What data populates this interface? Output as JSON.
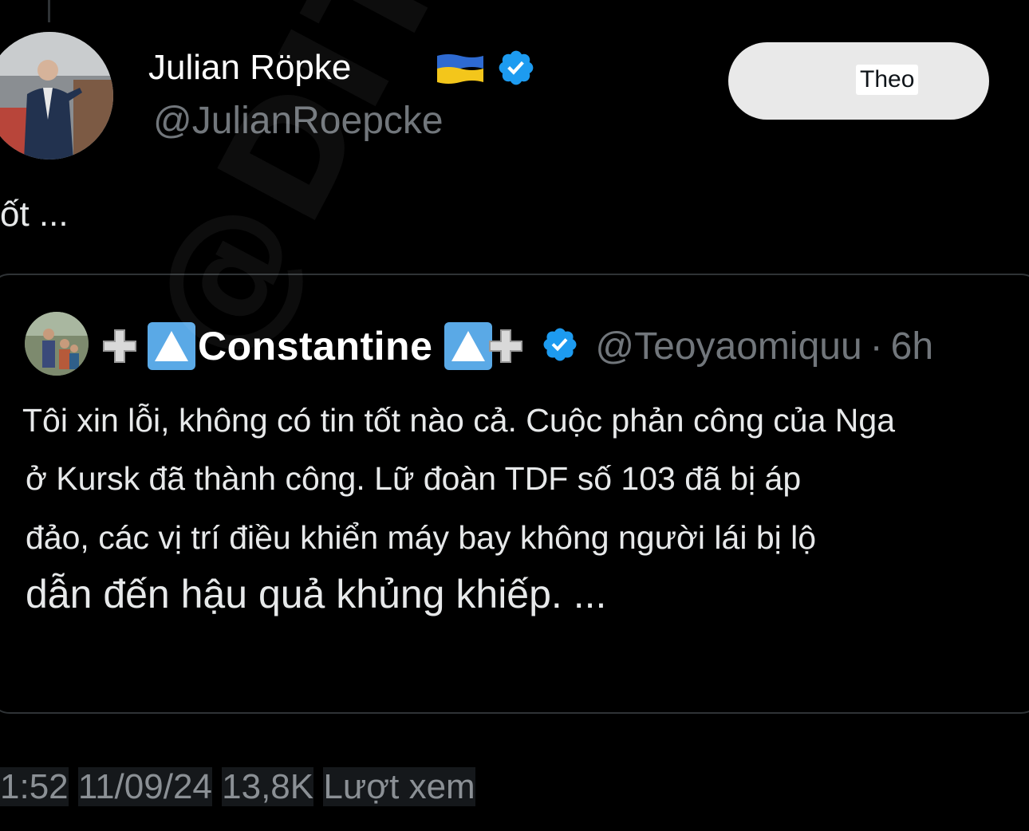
{
  "main_tweet": {
    "display_name": "Julian Röpke",
    "handle": "@JulianRoepcke",
    "follow_label": "Theo",
    "text": "ốt ...",
    "flag_icon": "ukraine-flag-icon",
    "verified_icon": "verified-badge-icon",
    "verified_color": "#1d9bf0"
  },
  "quote_tweet": {
    "name": "Constantine",
    "handle": "@Teoyaomiquu",
    "separator": "·",
    "time": "6h",
    "text_lines": [
      "Tôi xin lỗi, không có tin tốt nào cả. Cuộc phản công của Nga",
      "ở Kursk đã thành công. Lữ đoàn TDF số 103 đã bị áp",
      "đảo, các vị trí điều khiển máy bay không người lái bị lộ",
      "dẫn đến hậu quả khủng khiếp. ..."
    ]
  },
  "meta": {
    "time": "1:52",
    "date": "11/09/24",
    "views_count": "13,8K",
    "views_label": "Lượt xem"
  },
  "watermark": "@DITOPOLIT"
}
